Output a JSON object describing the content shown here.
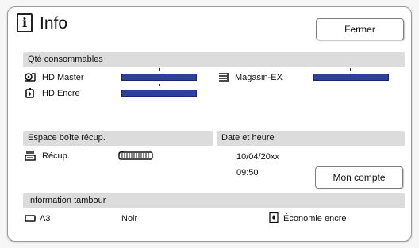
{
  "header": {
    "title": "Info",
    "close_label": "Fermer"
  },
  "consumables": {
    "heading": "Qté consommables",
    "items": [
      {
        "icon": "master-roll-icon",
        "label": "HD Master",
        "level": 1.0
      },
      {
        "icon": "ink-cartridge-icon",
        "label": "HD Encre",
        "level": 1.0
      },
      {
        "icon": "paper-stack-icon",
        "label": "Magasin-EX",
        "level": 1.0
      }
    ]
  },
  "disposal": {
    "heading": "Espace boîte récup.",
    "label": "Récup.",
    "icon": "disposal-box-icon"
  },
  "datetime": {
    "heading": "Date et heure",
    "date": "10/04/20xx",
    "time": "09:50",
    "account_label": "Mon compte"
  },
  "drum": {
    "heading": "Information tambour",
    "size": "A3",
    "color": "Noir",
    "mode": "Économie encre"
  },
  "colors": {
    "gauge": "#2f3f9e",
    "section_bar": "#dcdcdc"
  }
}
